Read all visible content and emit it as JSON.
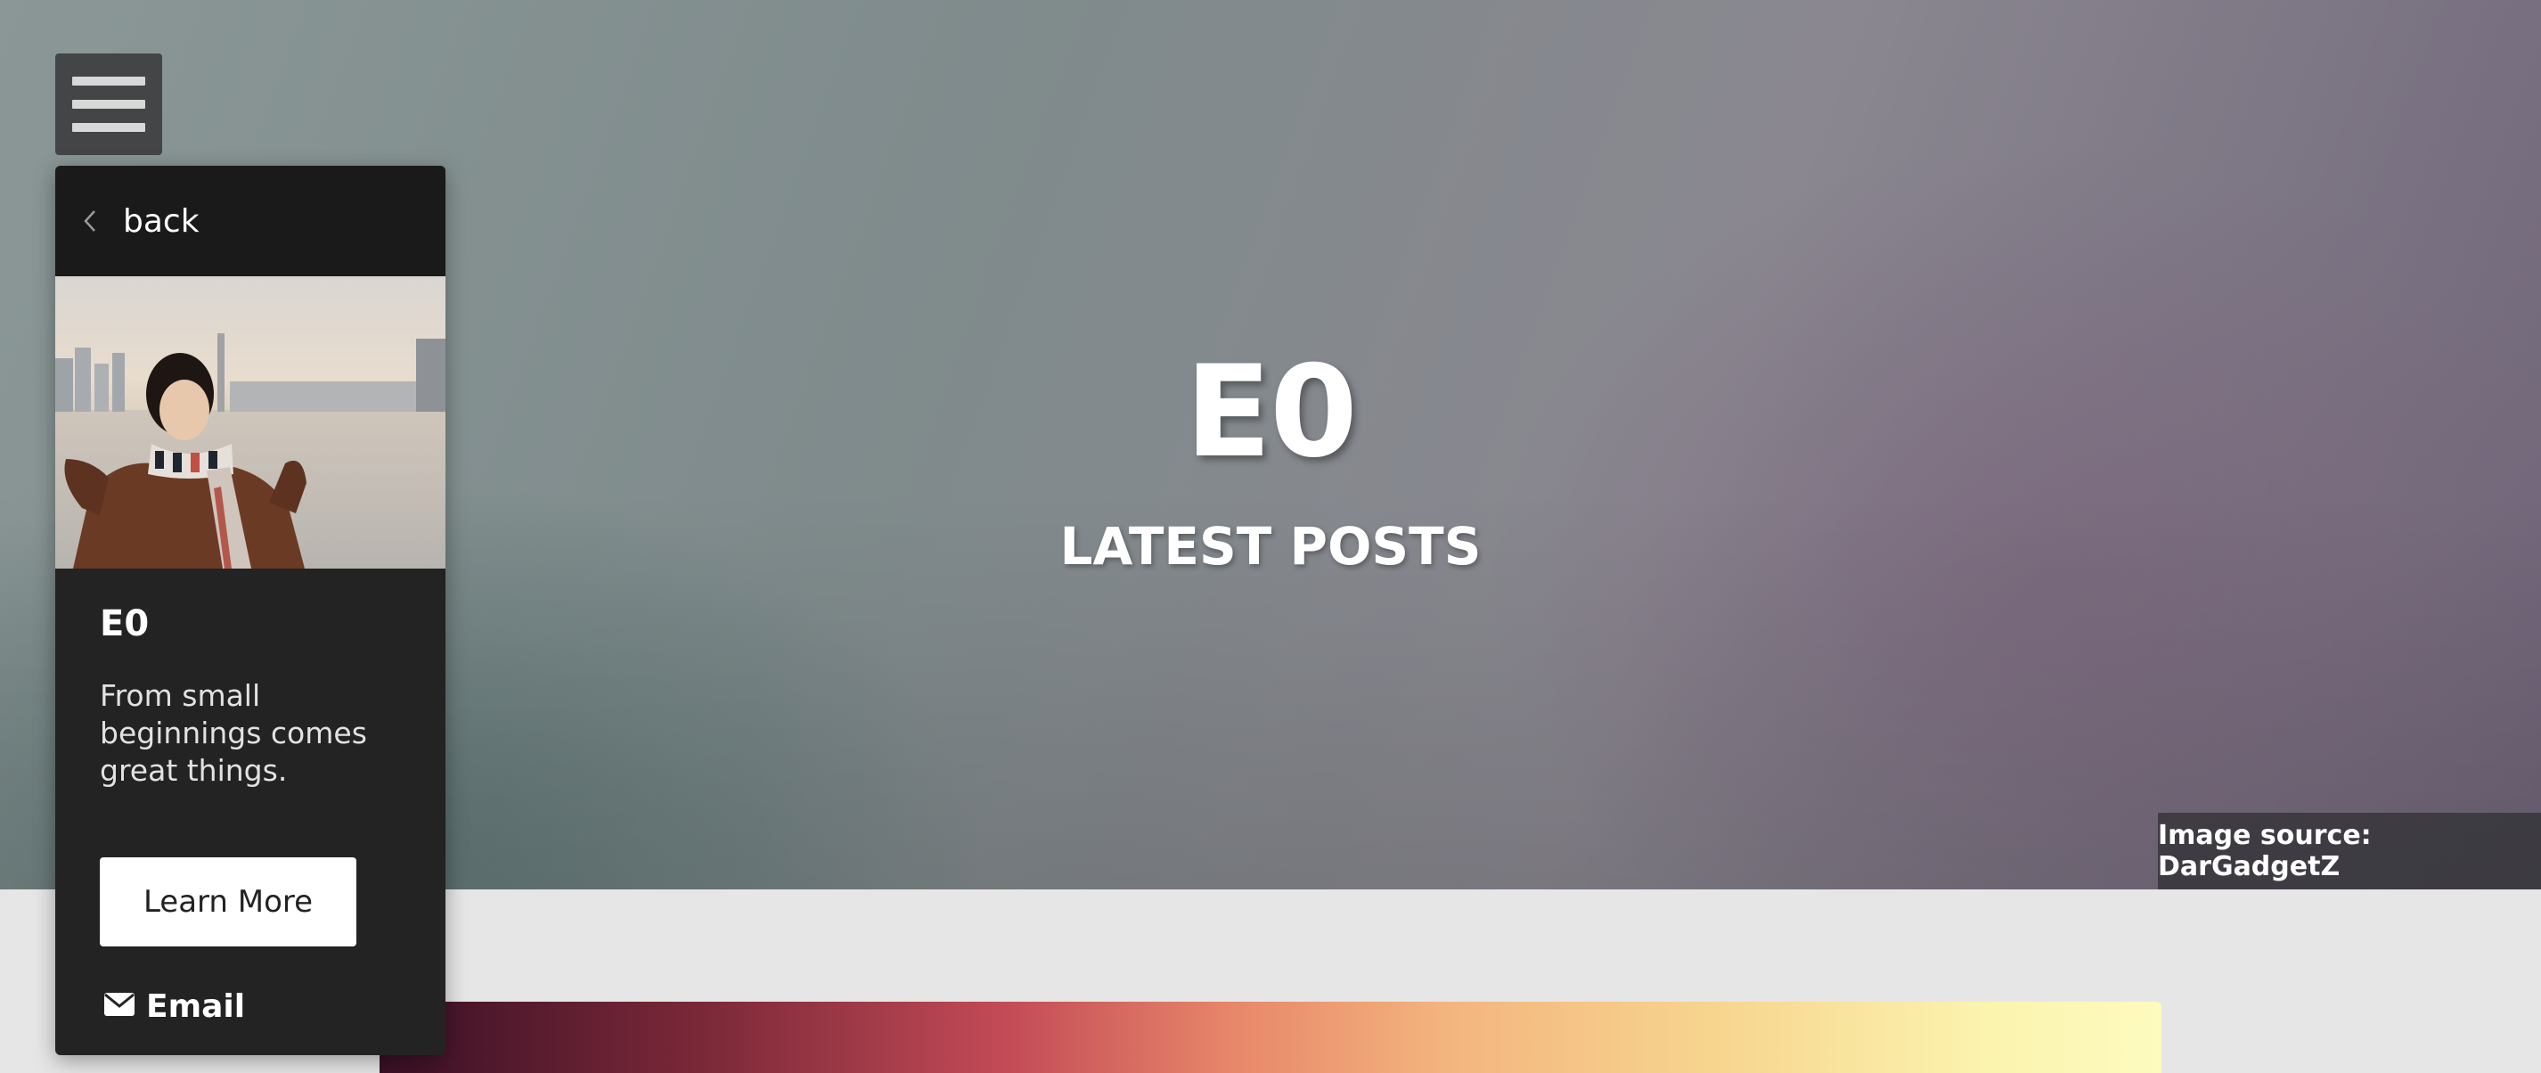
{
  "hero": {
    "title": "E0",
    "subtitle": "LATEST POSTS",
    "image_source": "Image source: DarGadgetZ"
  },
  "menu": {
    "icon": "hamburger-menu-icon"
  },
  "panel": {
    "back_label": "back",
    "back_icon": "chevron-left-icon",
    "title": "E0",
    "tagline": "From small beginnings comes great things.",
    "button_label": "Learn More",
    "email_label": "Email",
    "email_icon": "envelope-icon"
  },
  "colors": {
    "panel_bg": "#232323",
    "panel_header_bg": "#1a1a1a",
    "page_bg": "#e6e6e6",
    "button_bg": "#ffffff"
  }
}
